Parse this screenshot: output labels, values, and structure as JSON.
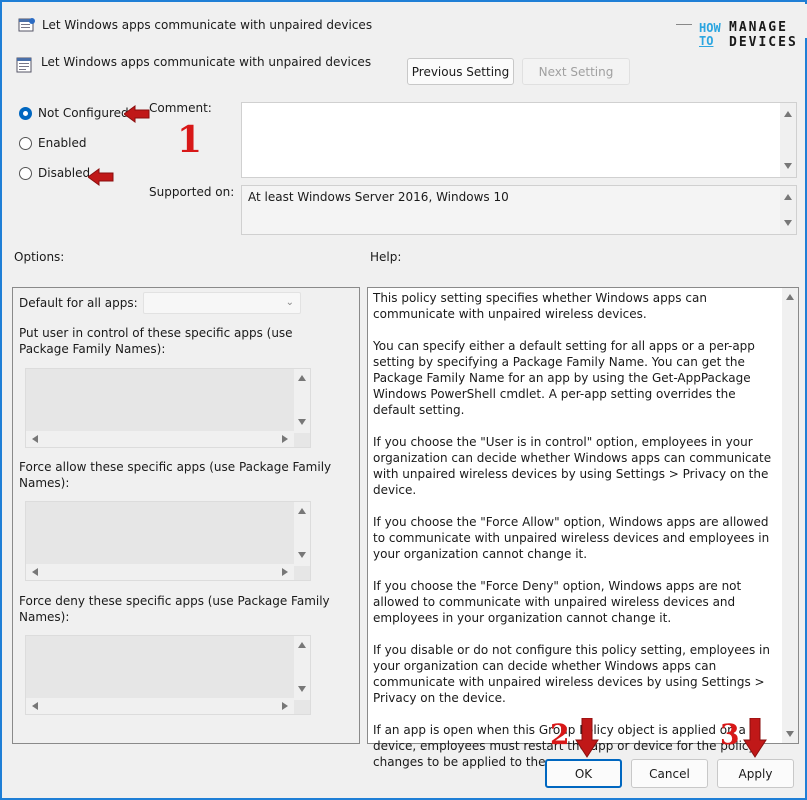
{
  "window": {
    "title": "Let Windows apps communicate with unpaired devices",
    "accent": "#1f7fd6"
  },
  "logo": {
    "how": "HOW",
    "to": "TO",
    "manage": "MANAGE",
    "devices": "DEVICES"
  },
  "header": {
    "setting_name": "Let Windows apps communicate with unpaired devices",
    "previous_label": "Previous Setting",
    "next_label": "Next Setting"
  },
  "state": {
    "options": [
      {
        "label": "Not Configured",
        "checked": true
      },
      {
        "label": "Enabled",
        "checked": false
      },
      {
        "label": "Disabled",
        "checked": false
      }
    ]
  },
  "labels": {
    "comment": "Comment:",
    "supported_on": "Supported on:",
    "options": "Options:",
    "help": "Help:"
  },
  "supported_value": "At least Windows Server 2016, Windows 10",
  "options_panel": {
    "default_label": "Default for all apps:",
    "user_control_label": "Put user in control of these specific apps (use Package Family Names):",
    "force_allow_label": "Force allow these specific apps (use Package Family Names):",
    "force_deny_label": "Force deny these specific apps (use Package Family Names):"
  },
  "help_paragraphs": [
    "This policy setting specifies whether Windows apps can communicate with unpaired wireless devices.",
    "You can specify either a default setting for all apps or a per-app setting by specifying a Package Family Name. You can get the Package Family Name for an app by using the Get-AppPackage Windows PowerShell cmdlet. A per-app setting overrides the default setting.",
    "If you choose the \"User is in control\" option, employees in your organization can decide whether Windows apps can communicate with unpaired wireless devices by using Settings > Privacy on the device.",
    "If you choose the \"Force Allow\" option, Windows apps are allowed to communicate with unpaired wireless devices and employees in your organization cannot change it.",
    "If you choose the \"Force Deny\" option, Windows apps are not allowed to communicate with unpaired wireless devices and employees in your organization cannot change it.",
    "If you disable or do not configure this policy setting, employees in your organization can decide whether Windows apps can communicate with unpaired wireless devices by using Settings > Privacy on the device.",
    "If an app is open when this Group Policy object is applied on a device, employees must restart the app or device for the policy changes to be applied to the app."
  ],
  "footer": {
    "ok_label": "OK",
    "cancel_label": "Cancel",
    "apply_label": "Apply"
  },
  "annotations": {
    "step1": "1",
    "step2": "2",
    "step3": "3",
    "color": "#d81818"
  }
}
